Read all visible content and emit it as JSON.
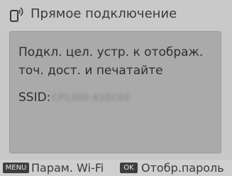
{
  "header": {
    "title": "Прямое подключение",
    "icon": "wifi-phone-icon"
  },
  "message": {
    "line1": "Подкл. цел. устр. к отображ.",
    "line2": "точ. дост. и печатайте"
  },
  "ssid": {
    "label": "SSID:",
    "value": "CP1300-A1EC00"
  },
  "footer": {
    "menu_key": "MENU",
    "menu_label": "Парам. Wi-Fi",
    "ok_key": "OK",
    "ok_label": "Отобр.пароль"
  }
}
